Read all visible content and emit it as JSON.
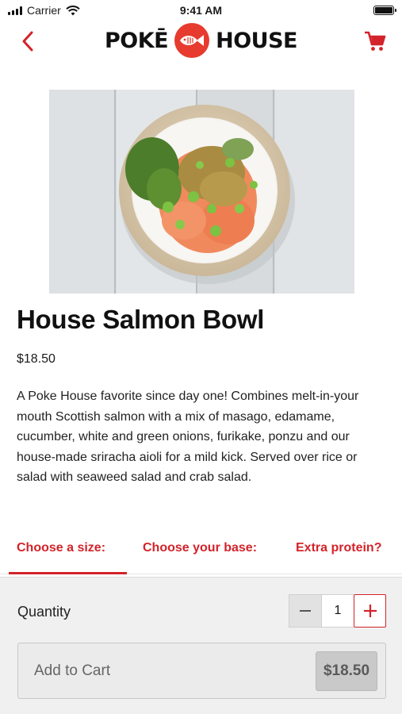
{
  "status_bar": {
    "carrier": "Carrier",
    "time": "9:41 AM"
  },
  "header": {
    "logo_left": "POKĒ",
    "logo_right": "HOUSE"
  },
  "product": {
    "title": "House Salmon Bowl",
    "price": "$18.50",
    "description": "A Poke House favorite since day one! Combines melt-in-your mouth Scottish salmon with a mix of masago, edamame, cucumber, white and green onions, furikake, ponzu and our house-made sriracha aioli for a mild kick. Served over rice or salad with seaweed salad and crab salad."
  },
  "options": {
    "tabs": [
      {
        "label": "Choose a size:",
        "active": true
      },
      {
        "label": "Choose your base:"
      },
      {
        "label": "Extra protein?"
      }
    ]
  },
  "footer": {
    "quantity_label": "Quantity",
    "quantity_value": "1",
    "add_to_cart_label": "Add to Cart",
    "add_to_cart_price": "$18.50"
  },
  "colors": {
    "accent": "#d3232a",
    "logo_red": "#e63b2e"
  },
  "icons": {
    "back": "chevron-left-icon",
    "cart": "cart-icon",
    "minus": "minus-icon",
    "plus": "plus-icon",
    "logo": "fish-icon"
  }
}
